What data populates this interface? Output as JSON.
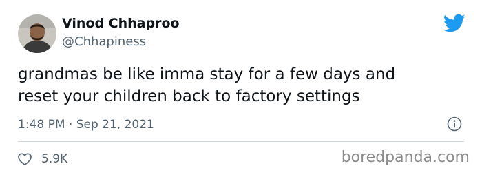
{
  "tweet": {
    "display_name": "Vinod Chhaproo",
    "handle": "@Chhapiness",
    "text_lines": [
      "grandmas be like imma stay for a few days and",
      "reset your children back to factory settings"
    ],
    "time": "1:48 PM",
    "separator": "·",
    "date": "Sep 21, 2021",
    "likes": "5.9K"
  },
  "icons": {
    "brand": "twitter-bird-icon",
    "info": "info-icon",
    "like": "heart-icon"
  },
  "colors": {
    "twitter_blue": "#1d9bf0",
    "secondary_text": "#536471",
    "primary_text": "#0f1419",
    "divider": "#cfd9de"
  },
  "watermark": "boredpanda.com"
}
